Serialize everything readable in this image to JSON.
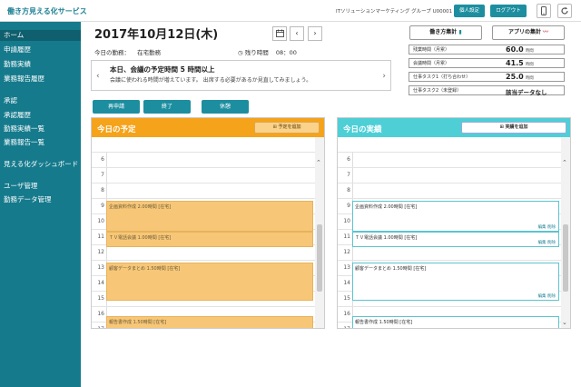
{
  "header": {
    "brand": "働き方見える化サービス",
    "user": "ITソリューションマーケティング グループ U00001 日本太郎",
    "personal_settings": "個人設定",
    "logout": "ログアウト",
    "mobile_icon": "mobile-icon",
    "refresh_icon": "refresh-icon"
  },
  "sidebar": {
    "items": [
      {
        "label": "ホーム",
        "active": true
      },
      {
        "label": "申請履歴"
      },
      {
        "label": "勤務実績"
      },
      {
        "label": "業務報告履歴"
      },
      {
        "label": "承認"
      },
      {
        "label": "承認履歴"
      },
      {
        "label": "勤務実績一覧"
      },
      {
        "label": "業務報告一覧"
      },
      {
        "label": "見える化ダッシュボード"
      },
      {
        "label": "ユーザ管理"
      },
      {
        "label": "勤務データ管理"
      }
    ]
  },
  "main": {
    "date": "2017年10月12日(木)",
    "work_status_label": "今日の勤務：",
    "work_status_value": "在宅勤務",
    "remaining_label": "残り時間",
    "remaining_value": "08：00",
    "message_title": "本日、会議の予定時間 5 時間以上",
    "message_body": "会議に使われる時間が増えています。 出席する必要があるか見直してみましょう。",
    "work_summary": "働き方集計",
    "app_summary": "アプリの集計",
    "stats": [
      {
        "label": "残業時間（月累）",
        "value": "60.0",
        "unit": "時間"
      },
      {
        "label": "会議時間（月累）",
        "value": "41.5",
        "unit": "時間"
      },
      {
        "label": "仕事タスク1（打ち合わせ）",
        "value": "25.0",
        "unit": "時間"
      },
      {
        "label": "仕事タスク2（未登録）",
        "value": "該当データなし",
        "unit": ""
      }
    ],
    "actions": [
      "再申請",
      "終了",
      "休憩"
    ]
  },
  "plan_panel": {
    "title": "今日の予定",
    "add_button": "予定を追加",
    "color": "#f5a31a",
    "events": [
      {
        "text": "企画資料作成 2.00時間 [在宅]"
      },
      {
        "text": "ＴＶ電話会議 1.00時間 [在宅]"
      },
      {
        "text": "顧客データまとめ 1.50時間 [在宅]"
      },
      {
        "text": "報告書作成 1.50時間 [在宅]"
      }
    ]
  },
  "actual_panel": {
    "title": "今日の実績",
    "add_button": "実績を追加",
    "color": "#4ecfd6",
    "edit": "編集",
    "delete": "削除",
    "events": [
      {
        "text": "企画資料作成 2.00時間 [在宅]"
      },
      {
        "text": "ＴＶ電話会議 1.00時間 [在宅]"
      },
      {
        "text": "顧客データまとめ 1.50時間 [在宅]"
      },
      {
        "text": "報告書作成 1.50時間 [在宅]"
      }
    ]
  },
  "hours": [
    "6",
    "7",
    "8",
    "9",
    "10",
    "11",
    "12",
    "13",
    "14",
    "15",
    "16",
    "17"
  ]
}
